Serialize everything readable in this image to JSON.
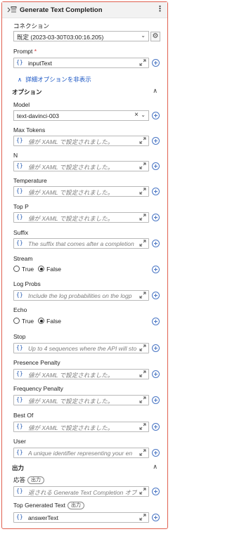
{
  "header": {
    "title": "Generate Text Completion",
    "menu_icon": "more-vertical-icon"
  },
  "connection": {
    "label": "コネクション",
    "value": "既定 (2023-03-30T03:00:16.205)"
  },
  "prompt": {
    "label": "Prompt",
    "required_mark": "*",
    "value": "inputText"
  },
  "advanced_toggle": {
    "label": "詳細オプションを非表示"
  },
  "options_section": {
    "title": "オプション"
  },
  "model": {
    "label": "Model",
    "value": "text-davinci-003"
  },
  "max_tokens": {
    "label": "Max Tokens",
    "placeholder": "値が XAML で設定されました。"
  },
  "n": {
    "label": "N",
    "placeholder": "値が XAML で設定されました。"
  },
  "temperature": {
    "label": "Temperature",
    "placeholder": "値が XAML で設定されました。"
  },
  "top_p": {
    "label": "Top P",
    "placeholder": "値が XAML で設定されました。"
  },
  "suffix": {
    "label": "Suffix",
    "placeholder": "The suffix that comes after a completion"
  },
  "stream": {
    "label": "Stream",
    "true_label": "True",
    "false_label": "False",
    "selected": "False"
  },
  "log_probs": {
    "label": "Log Probs",
    "placeholder": "Include the log probabilities on the logp"
  },
  "echo": {
    "label": "Echo",
    "true_label": "True",
    "false_label": "False",
    "selected": "False"
  },
  "stop": {
    "label": "Stop",
    "placeholder": "Up to 4 sequences where the API will sto"
  },
  "presence_penalty": {
    "label": "Presence Penalty",
    "placeholder": "値が XAML で設定されました。"
  },
  "frequency_penalty": {
    "label": "Frequency Penalty",
    "placeholder": "値が XAML で設定されました。"
  },
  "best_of": {
    "label": "Best Of",
    "placeholder": "値が XAML で設定されました。"
  },
  "user": {
    "label": "User",
    "placeholder": "A unique identifier representing your en"
  },
  "output_section": {
    "title": "出力"
  },
  "response": {
    "label": "応答",
    "badge": "出力",
    "placeholder": "返される Generate Text Completion オブジ"
  },
  "top_generated_text": {
    "label": "Top Generated Text",
    "badge": "出力",
    "value": "answerText"
  },
  "brace_glyph": "{}"
}
